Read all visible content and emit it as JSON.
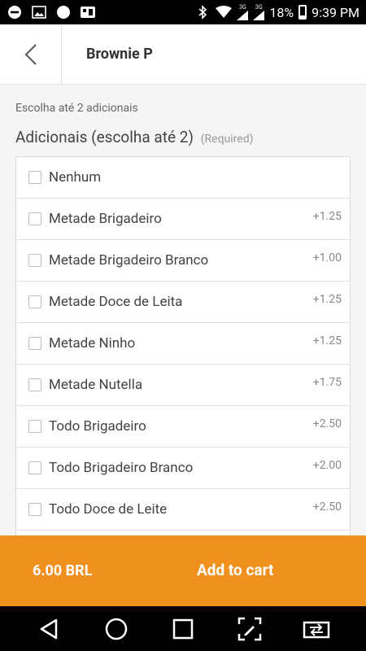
{
  "status_bar": {
    "battery_percent": "18%",
    "time": "9:39 PM",
    "network_label_1": "3G",
    "network_label_2": "3G"
  },
  "header": {
    "title": "Brownie P"
  },
  "hint": "Escolha até 2 adicionais",
  "section": {
    "title": "Adicionais (escolha até 2)",
    "required_label": "(Required)"
  },
  "options": [
    {
      "label": "Nenhum",
      "price": ""
    },
    {
      "label": "Metade Brigadeiro",
      "price": "+1.25"
    },
    {
      "label": "Metade Brigadeiro Branco",
      "price": "+1.00"
    },
    {
      "label": "Metade Doce de Leita",
      "price": "+1.25"
    },
    {
      "label": "Metade Ninho",
      "price": "+1.25"
    },
    {
      "label": "Metade Nutella",
      "price": "+1.75"
    },
    {
      "label": "Todo Brigadeiro",
      "price": "+2.50"
    },
    {
      "label": "Todo Brigadeiro Branco",
      "price": "+2.00"
    },
    {
      "label": "Todo Doce de Leite",
      "price": "+2.50"
    },
    {
      "label": "",
      "price": ""
    }
  ],
  "cart": {
    "total": "6.00 BRL",
    "add_label": "Add to cart"
  },
  "colors": {
    "accent": "#f0901e"
  }
}
